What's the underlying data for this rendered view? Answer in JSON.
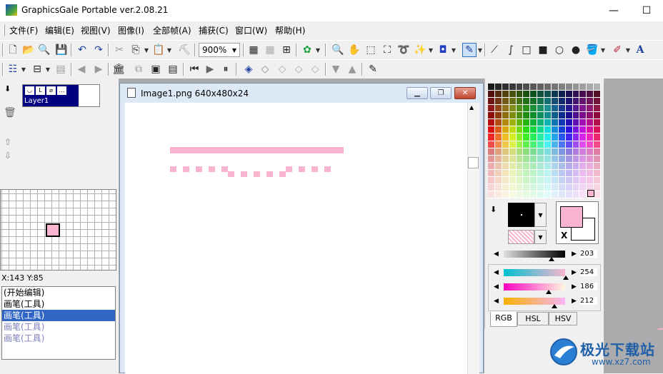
{
  "window": {
    "title": "GraphicsGale Portable ver.2.08.21",
    "controls": [
      "—",
      "☐",
      "✕"
    ]
  },
  "menu": [
    "文件(F)",
    "编辑(E)",
    "视图(V)",
    "图像(I)",
    "全部帧(A)",
    "捕获(C)",
    "窗口(W)",
    "帮助(H)"
  ],
  "toolbar": {
    "zoom_value": "900%"
  },
  "layers": {
    "layer_name": "Layer1"
  },
  "status": {
    "coords": "X:143 Y:85"
  },
  "history": [
    "(开始编辑)",
    "画笔(工具)",
    "画笔(工具)",
    "画笔(工具)",
    "画笔(工具)"
  ],
  "history_selected_index": 2,
  "document": {
    "title": "Image1.png  640x480x24"
  },
  "colors": {
    "drawing_color": "#f9b5d0",
    "foreground_block": "#000000",
    "background": "#ffffff",
    "selection": "#3166c5"
  },
  "sliders": {
    "value": {
      "label": "",
      "value": "203"
    },
    "r": {
      "value": "254"
    },
    "g": {
      "value": "186"
    },
    "b": {
      "value": "212"
    }
  },
  "color_tabs": [
    "RGB",
    "HSL",
    "HSV"
  ],
  "watermark": {
    "text": "极光下载站",
    "url": "www.xz7.com"
  }
}
